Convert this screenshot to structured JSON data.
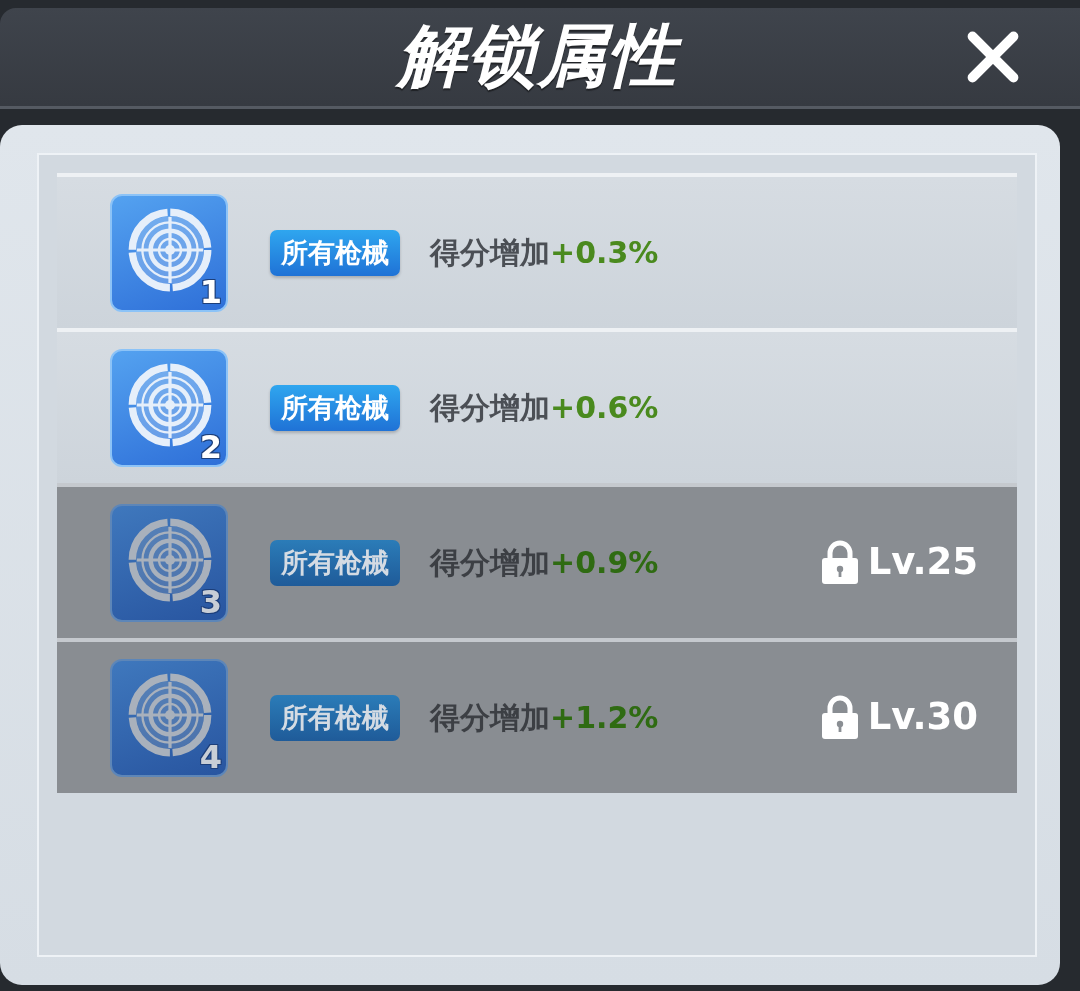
{
  "header": {
    "title": "解锁属性"
  },
  "attributes": [
    {
      "number": "1",
      "tag": "所有枪械",
      "label": "得分增加",
      "value": "+0.3%",
      "locked": false
    },
    {
      "number": "2",
      "tag": "所有枪械",
      "label": "得分增加",
      "value": "+0.6%",
      "locked": false
    },
    {
      "number": "3",
      "tag": "所有枪械",
      "label": "得分增加",
      "value": "+0.9%",
      "locked": true,
      "unlock_level": "Lv.25"
    },
    {
      "number": "4",
      "tag": "所有枪械",
      "label": "得分增加",
      "value": "+1.2%",
      "locked": true,
      "unlock_level": "Lv.30"
    }
  ]
}
